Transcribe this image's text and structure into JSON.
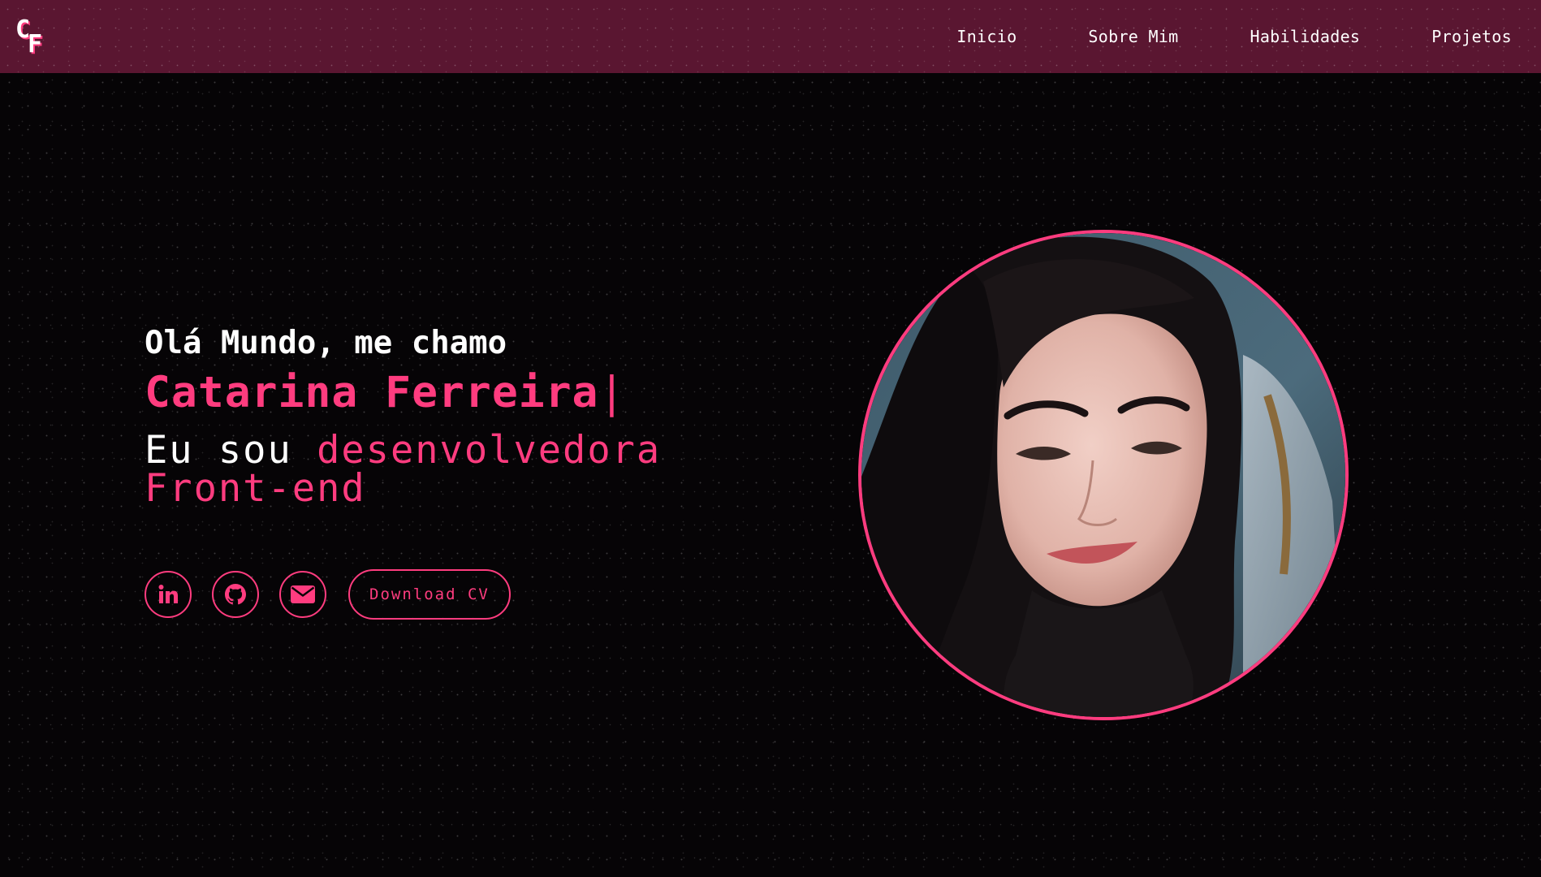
{
  "header": {
    "logo": {
      "text": "CF",
      "icon": "cf-monogram-logo"
    },
    "nav": [
      {
        "label": "Inicio"
      },
      {
        "label": "Sobre Mim"
      },
      {
        "label": "Habilidades"
      },
      {
        "label": "Projetos"
      }
    ]
  },
  "hero": {
    "greeting": "Olá Mundo, me chamo",
    "name": "Catarina Ferreira",
    "cursor": "|",
    "role_prefix": "Eu sou",
    "role_highlight": "desenvolvedora Front-end"
  },
  "actions": {
    "social": [
      {
        "name": "linkedin-icon"
      },
      {
        "name": "github-icon"
      },
      {
        "name": "envelope-icon"
      }
    ],
    "download_cv_label": "Download CV"
  },
  "portrait": {
    "description_icon": "profile-photo"
  },
  "colors": {
    "accent": "#ff3c7f",
    "header_bg": "#5a1631",
    "page_bg": "#060406",
    "text": "#ffffff"
  }
}
